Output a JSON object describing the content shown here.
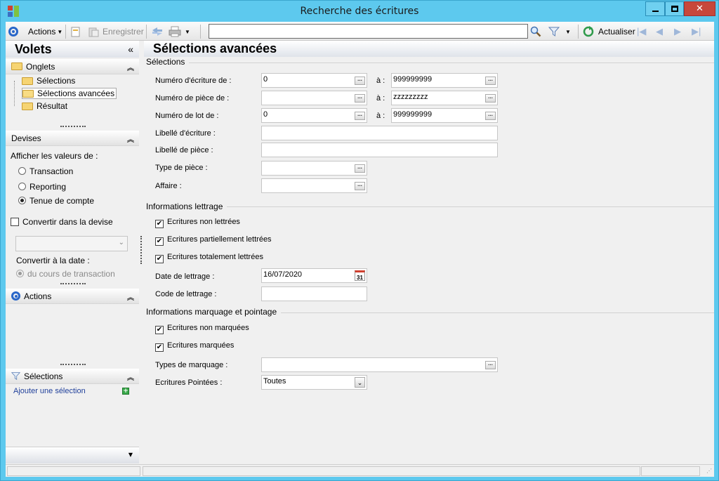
{
  "window": {
    "title": "Recherche des écritures"
  },
  "toolbar": {
    "actions_label": "Actions",
    "save_label": "Enregistrer",
    "search_value": "",
    "refresh_label": "Actualiser"
  },
  "left": {
    "title": "Volets",
    "onglets": {
      "title": "Onglets",
      "items": [
        "Sélections",
        "Sélections avancées",
        "Résultat"
      ]
    },
    "devises": {
      "title": "Devises",
      "show_values_label": "Afficher les valeurs de :",
      "radios": [
        "Transaction",
        "Reporting",
        "Tenue de compte"
      ],
      "selected": "Tenue de compte",
      "convert_label": "Convertir dans la devise",
      "convert_date_label": "Convertir à la date :",
      "date_radio": "du cours de transaction"
    },
    "actions": {
      "title": "Actions"
    },
    "selections": {
      "title": "Sélections",
      "add_link": "Ajouter une sélection"
    }
  },
  "main": {
    "title": "Sélections avancées",
    "groups": {
      "selections": "Sélections",
      "lettrage": "Informations lettrage",
      "marquage": "Informations marquage et pointage"
    },
    "a_label": "à :",
    "fields": {
      "num_ecriture": {
        "label": "Numéro d'écriture de :",
        "from": "0",
        "to": "999999999"
      },
      "num_piece": {
        "label": "Numéro de pièce de :",
        "from": "",
        "to": "zzzzzzzzz"
      },
      "num_lot": {
        "label": "Numéro de lot de :",
        "from": "0",
        "to": "999999999"
      },
      "libelle_ecriture": {
        "label": "Libellé d'écriture :",
        "value": ""
      },
      "libelle_piece": {
        "label": "Libellé de pièce :",
        "value": ""
      },
      "type_piece": {
        "label": "Type de pièce :",
        "value": ""
      },
      "affaire": {
        "label": "Affaire :",
        "value": ""
      }
    },
    "lettrage": {
      "checks": [
        "Ecritures non lettrées",
        "Ecritures partiellement lettrées",
        "Ecritures totalement lettrées"
      ],
      "date_label": "Date de lettrage :",
      "date_value": "16/07/2020",
      "calendar_day": "31",
      "code_label": "Code de lettrage :",
      "code_value": ""
    },
    "marquage": {
      "checks": [
        "Ecritures non marquées",
        "Ecritures marquées"
      ],
      "types_label": "Types de marquage :",
      "types_value": "",
      "pointees_label": "Ecritures Pointées :",
      "pointees_value": "Toutes"
    }
  },
  "colors": {
    "titlebar": "#5dc9ee",
    "accent": "#2a67c9",
    "close": "#c7473b"
  }
}
